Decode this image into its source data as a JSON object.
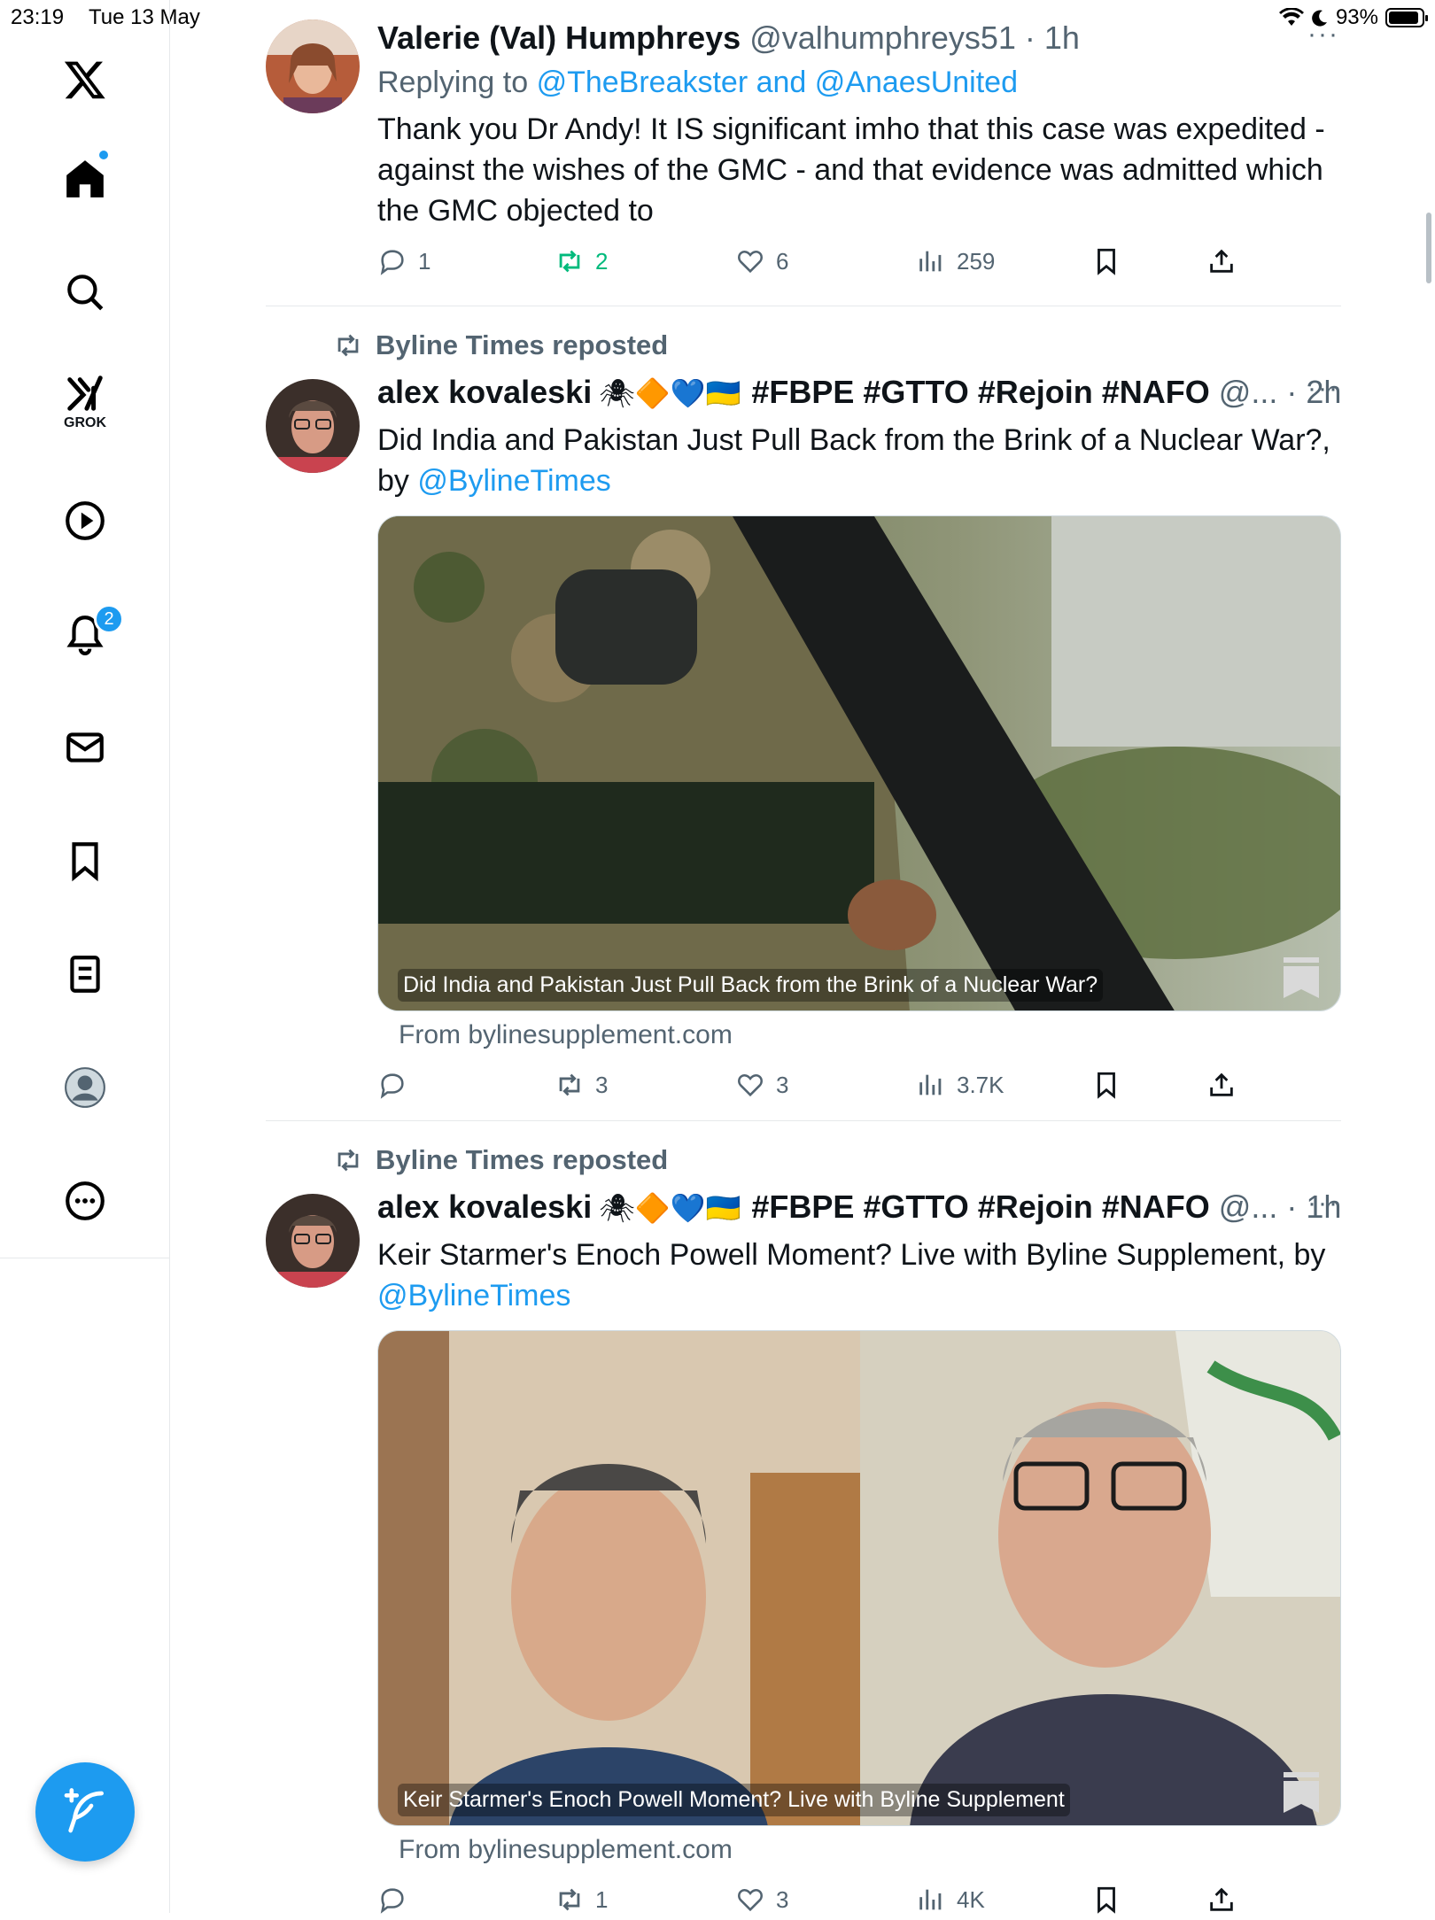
{
  "status_bar": {
    "time": "23:19",
    "date": "Tue 13 May",
    "battery": "93%",
    "battery_level": 0.93
  },
  "sidebar": {
    "items": [
      {
        "icon": "x-logo-icon"
      },
      {
        "icon": "home-icon"
      },
      {
        "icon": "search-icon"
      },
      {
        "icon": "grok-icon",
        "label": "GROK"
      },
      {
        "icon": "video-play-icon"
      },
      {
        "icon": "notifications-icon",
        "badge": "2"
      },
      {
        "icon": "mail-icon"
      },
      {
        "icon": "bookmarks-icon"
      },
      {
        "icon": "lists-icon"
      },
      {
        "icon": "profile-icon"
      },
      {
        "icon": "more-icon"
      }
    ],
    "compose_icon": "compose-icon"
  },
  "tweets": [
    {
      "name": "Valerie (Val) Humphreys",
      "handle": "@valhumphreys51 · 1h",
      "replying_prefix": "Replying to",
      "replying_to": "@TheBreakster and @AnaesUnited",
      "text": "Thank you Dr Andy! It IS significant imho that this case was expedited - against the wishes of the GMC - and that evidence was admitted which the GMC objected to",
      "replies": "1",
      "reposts": "2",
      "likes": "6",
      "views": "259"
    },
    {
      "repost_label": "Byline Times reposted",
      "name": "alex kovaleski",
      "name_emoji": "🕷🔶💙🇺🇦",
      "name_tags": "#FBPE #GTTO #Rejoin #NAFO",
      "handle": "@... · 2h",
      "text_main": "Did India and Pakistan Just Pull Back from the Brink of a Nuclear War?, by ",
      "text_link": "@BylineTimes",
      "card_caption": "Did India and Pakistan Just Pull Back from the Brink of a Nuclear War?",
      "card_source": "From bylinesupplement.com",
      "replies": "",
      "reposts": "3",
      "likes": "3",
      "views": "3.7K"
    },
    {
      "repost_label": "Byline Times reposted",
      "name": "alex kovaleski",
      "name_emoji": "🕷🔶💙🇺🇦",
      "name_tags": "#FBPE #GTTO #Rejoin #NAFO",
      "handle": "@... · 1h",
      "text_main": "Keir Starmer's Enoch Powell Moment? Live with Byline Supplement, by ",
      "text_link": "@BylineTimes",
      "card_caption": "Keir Starmer's Enoch Powell Moment? Live with Byline Supplement",
      "card_source": "From bylinesupplement.com",
      "replies": "",
      "reposts": "1",
      "likes": "3",
      "views": "4K"
    }
  ],
  "colors": {
    "accent": "#1d9bf0",
    "repost_green": "#00ba7c",
    "secondary_text": "#536471"
  }
}
